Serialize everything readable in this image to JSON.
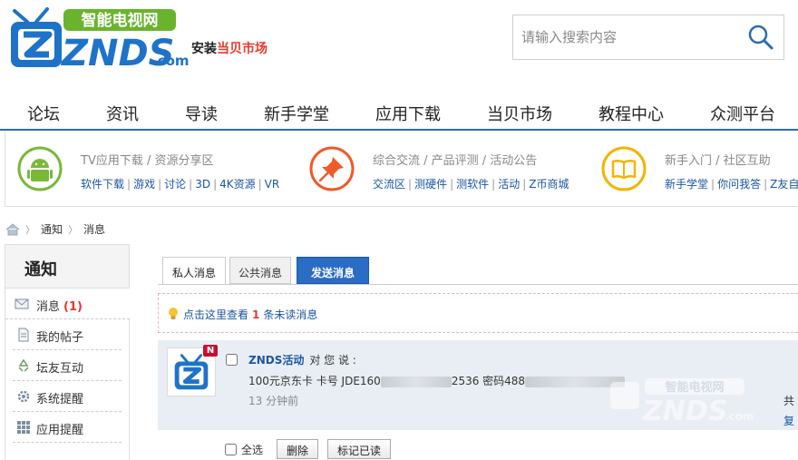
{
  "brand": {
    "logo_main": "ZNDS",
    "logo_dotcom": ".com",
    "logo_tagline": "智能电视网",
    "sub_prefix": "安装",
    "sub_highlight": "当贝市场"
  },
  "search": {
    "placeholder": "请输入搜索内容"
  },
  "nav": [
    "论坛",
    "资讯",
    "导读",
    "新手学堂",
    "应用下载",
    "当贝市场",
    "教程中心",
    "众测平台"
  ],
  "categories": [
    {
      "title": "TV应用下载 / 资源分享区",
      "links": [
        "软件下载",
        "游戏",
        "讨论",
        "3D",
        "4K资源",
        "VR"
      ],
      "icon": "android-icon",
      "color": "#79b93a"
    },
    {
      "title": "综合交流 / 产品评测 / 活动公告",
      "links": [
        "交流区",
        "测硬件",
        "测软件",
        "活动",
        "Z币商城"
      ],
      "icon": "pin-icon",
      "color": "#ef5a2a"
    },
    {
      "title": "新手入门 / 社区互助",
      "links": [
        "新手学堂",
        "你问我答",
        "Z友自"
      ],
      "icon": "book-icon",
      "color": "#f4b400"
    }
  ],
  "breadcrumb": [
    "通知",
    "消息"
  ],
  "sidebar": {
    "title": "通知",
    "items": [
      {
        "label": "消息",
        "count": "(1)"
      },
      {
        "label": "我的帖子"
      },
      {
        "label": "坛友互动"
      },
      {
        "label": "系统提醒"
      },
      {
        "label": "应用提醒"
      }
    ]
  },
  "tabs": {
    "private": "私人消息",
    "public": "公共消息",
    "send": "发送消息"
  },
  "notice": {
    "prefix": "点击这里查看",
    "count": "1",
    "suffix": "条未读消息"
  },
  "message": {
    "badge": "N",
    "sender": "ZNDS活动",
    "said": "对 您 说 :",
    "content_a": "100元京东卡 卡号 JDE160",
    "content_b": "2536 密码488",
    "time": "13 分钟前",
    "action1": "共",
    "action2": "复",
    "watermark_tagline": "智能电视网",
    "watermark_main": "ZNDS",
    "watermark_dotcom": ".com"
  },
  "bottom": {
    "select_all": "全选",
    "delete": "删除",
    "mark_read": "标记已读"
  }
}
